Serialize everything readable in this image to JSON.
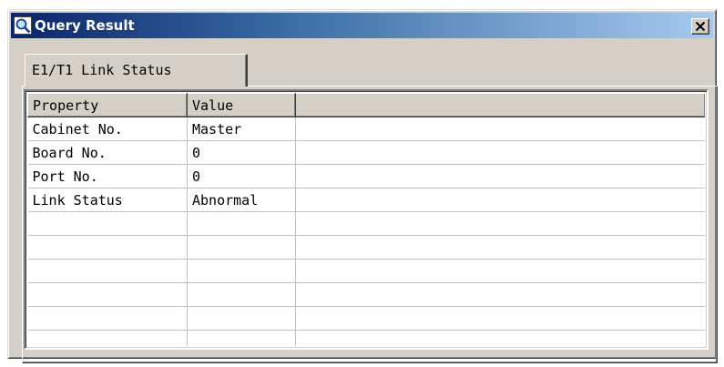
{
  "window": {
    "title": "Query Result",
    "close_symbol": "×"
  },
  "tabs": [
    {
      "label": "E1/T1 Link Status",
      "active": true
    }
  ],
  "table": {
    "columns": [
      "Property",
      "Value",
      ""
    ],
    "rows": [
      [
        "Cabinet No.",
        "Master",
        ""
      ],
      [
        "Board No.",
        "0",
        ""
      ],
      [
        "Port No.",
        "0",
        ""
      ],
      [
        "Link Status",
        "Abnormal",
        ""
      ],
      [
        "",
        "",
        ""
      ],
      [
        "",
        "",
        ""
      ],
      [
        "",
        "",
        ""
      ],
      [
        "",
        "",
        ""
      ],
      [
        "",
        "",
        ""
      ],
      [
        "",
        "",
        ""
      ]
    ]
  },
  "colors": {
    "face": "#d4d0c8",
    "title_start": "#0a246a",
    "title_end": "#a6caf0",
    "title_text": "#ffffff"
  },
  "icons": {
    "title": "query-magnifier-icon",
    "close": "close-icon"
  }
}
